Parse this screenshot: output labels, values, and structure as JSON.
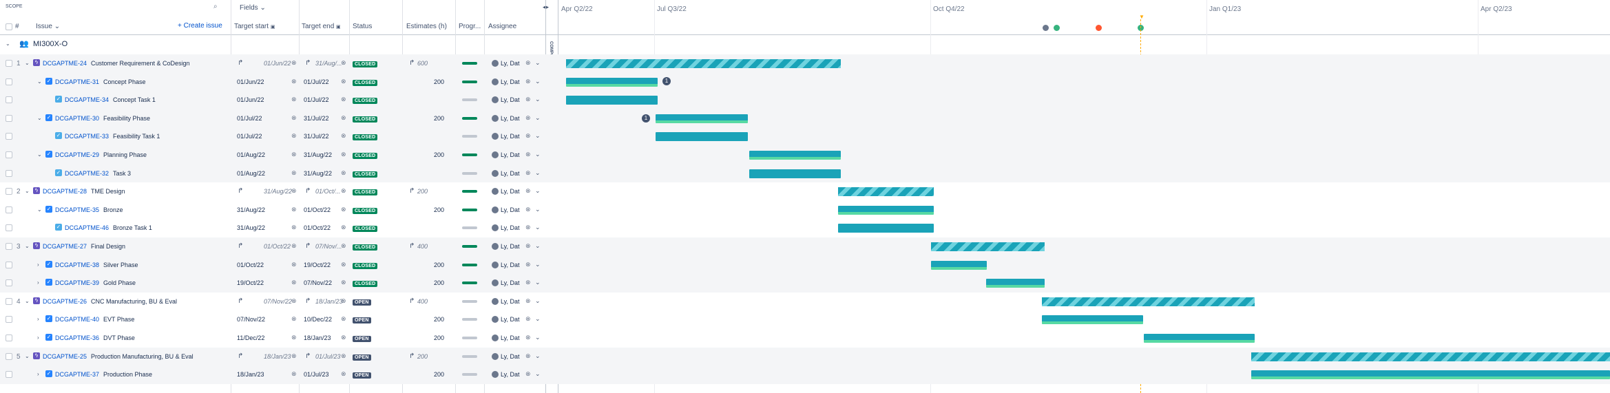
{
  "toolbar": {
    "scope_label": "SCOPE",
    "fields_label": "Fields",
    "create_issue_label": "Create issue"
  },
  "columns": {
    "hash": "#",
    "issue": "Issue",
    "target_start": "Target start",
    "target_end": "Target end",
    "status": "Status",
    "estimates": "Estimates (h)",
    "progress": "Progr...",
    "assignee": "Assignee"
  },
  "components_label": "COMPONENTS",
  "timeline": {
    "quarters": [
      "Apr Q2/22",
      "Jul Q3/22",
      "Oct Q4/22",
      "Jan Q1/23",
      "Apr Q2/23"
    ]
  },
  "group": {
    "name": "MI300X-O"
  },
  "rows": [
    {
      "num": "1",
      "key": "DCGAPTME-24",
      "summary": "Customer Requirement & CoDesign",
      "start": "01/Jun/22",
      "end": "31/Aug/...",
      "status": "CLOSED",
      "estimate": "600",
      "assignee": "Ly, Dat",
      "type": "epic"
    },
    {
      "num": "",
      "key": "DCGAPTME-31",
      "summary": "Concept Phase",
      "start": "01/Jun/22",
      "end": "01/Jul/22",
      "status": "CLOSED",
      "estimate": "200",
      "assignee": "Ly, Dat",
      "type": "story"
    },
    {
      "num": "",
      "key": "DCGAPTME-34",
      "summary": "Concept Task 1",
      "start": "01/Jun/22",
      "end": "01/Jul/22",
      "status": "CLOSED",
      "estimate": "",
      "assignee": "Ly, Dat",
      "type": "task"
    },
    {
      "num": "",
      "key": "DCGAPTME-30",
      "summary": "Feasibility Phase",
      "start": "01/Jul/22",
      "end": "31/Jul/22",
      "status": "CLOSED",
      "estimate": "200",
      "assignee": "Ly, Dat",
      "type": "story"
    },
    {
      "num": "",
      "key": "DCGAPTME-33",
      "summary": "Feasibility Task 1",
      "start": "01/Jul/22",
      "end": "31/Jul/22",
      "status": "CLOSED",
      "estimate": "",
      "assignee": "Ly, Dat",
      "type": "task"
    },
    {
      "num": "",
      "key": "DCGAPTME-29",
      "summary": "Planning Phase",
      "start": "01/Aug/22",
      "end": "31/Aug/22",
      "status": "CLOSED",
      "estimate": "200",
      "assignee": "Ly, Dat",
      "type": "story"
    },
    {
      "num": "",
      "key": "DCGAPTME-32",
      "summary": "Task 3",
      "start": "01/Aug/22",
      "end": "31/Aug/22",
      "status": "CLOSED",
      "estimate": "",
      "assignee": "Ly, Dat",
      "type": "task"
    },
    {
      "num": "2",
      "key": "DCGAPTME-28",
      "summary": "TME Design",
      "start": "31/Aug/22",
      "end": "01/Oct/...",
      "status": "CLOSED",
      "estimate": "200",
      "assignee": "Ly, Dat",
      "type": "epic"
    },
    {
      "num": "",
      "key": "DCGAPTME-35",
      "summary": "Bronze",
      "start": "31/Aug/22",
      "end": "01/Oct/22",
      "status": "CLOSED",
      "estimate": "200",
      "assignee": "Ly, Dat",
      "type": "story"
    },
    {
      "num": "",
      "key": "DCGAPTME-46",
      "summary": "Bronze Task 1",
      "start": "31/Aug/22",
      "end": "01/Oct/22",
      "status": "CLOSED",
      "estimate": "",
      "assignee": "Ly, Dat",
      "type": "task"
    },
    {
      "num": "3",
      "key": "DCGAPTME-27",
      "summary": "Final Design",
      "start": "01/Oct/22",
      "end": "07/Nov/...",
      "status": "CLOSED",
      "estimate": "400",
      "assignee": "Ly, Dat",
      "type": "epic"
    },
    {
      "num": "",
      "key": "DCGAPTME-38",
      "summary": "Silver Phase",
      "start": "01/Oct/22",
      "end": "19/Oct/22",
      "status": "CLOSED",
      "estimate": "200",
      "assignee": "Ly, Dat",
      "type": "story"
    },
    {
      "num": "",
      "key": "DCGAPTME-39",
      "summary": "Gold Phase",
      "start": "19/Oct/22",
      "end": "07/Nov/22",
      "status": "CLOSED",
      "estimate": "200",
      "assignee": "Ly, Dat",
      "type": "story"
    },
    {
      "num": "4",
      "key": "DCGAPTME-26",
      "summary": "CNC Manufacturing, BU & Eval",
      "start": "07/Nov/22",
      "end": "18/Jan/23",
      "status": "OPEN",
      "estimate": "400",
      "assignee": "Ly, Dat",
      "type": "epic"
    },
    {
      "num": "",
      "key": "DCGAPTME-40",
      "summary": "EVT Phase",
      "start": "07/Nov/22",
      "end": "10/Dec/22",
      "status": "OPEN",
      "estimate": "200",
      "assignee": "Ly, Dat",
      "type": "story"
    },
    {
      "num": "",
      "key": "DCGAPTME-36",
      "summary": "DVT Phase",
      "start": "11/Dec/22",
      "end": "18/Jan/23",
      "status": "OPEN",
      "estimate": "200",
      "assignee": "Ly, Dat",
      "type": "story"
    },
    {
      "num": "5",
      "key": "DCGAPTME-25",
      "summary": "Production Manufacturing, BU & Eval",
      "start": "18/Jan/23",
      "end": "01/Jul/23",
      "status": "OPEN",
      "estimate": "200",
      "assignee": "Ly, Dat",
      "type": "epic"
    },
    {
      "num": "",
      "key": "DCGAPTME-37",
      "summary": "Production Phase",
      "start": "18/Jan/23",
      "end": "01/Jul/23",
      "status": "OPEN",
      "estimate": "200",
      "assignee": "Ly, Dat",
      "type": "story"
    }
  ],
  "dependency_badges": [
    "1",
    "1"
  ],
  "colors": {
    "accent": "#0052cc",
    "closed": "#00875a",
    "open": "#42526e",
    "bar": "#1aa3b8",
    "today": "#ffab00"
  }
}
